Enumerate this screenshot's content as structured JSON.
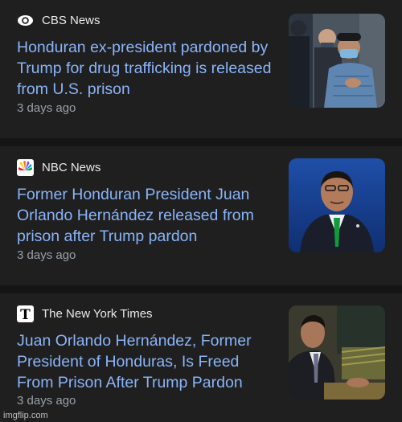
{
  "articles": [
    {
      "source": "CBS News",
      "logo_icon": "cbs-eye-icon",
      "headline": "Honduran ex-president pardoned by Trump for drug trafficking is released from U.S. prison",
      "time": "3 days ago",
      "thumb_icon": "photo-man-with-mask-thumbnail"
    },
    {
      "source": "NBC News",
      "logo_icon": "nbc-peacock-icon",
      "headline": "Former Honduran President Juan Orlando Hernández released from prison after Trump pardon",
      "time": "3 days ago",
      "thumb_icon": "photo-man-speaking-thumbnail"
    },
    {
      "source": "The New York Times",
      "logo_icon": "nyt-t-icon",
      "headline": "Juan Orlando Hernández, Former President of Honduras, Is Freed From Prison After Trump Pardon",
      "time": "3 days ago",
      "thumb_icon": "photo-man-at-podium-thumbnail"
    }
  ],
  "watermark": "imgflip.com",
  "colors": {
    "background": "#1f1f1f",
    "headline": "#8ab4f8",
    "source": "#e8eaed",
    "time": "#9aa0a6"
  }
}
